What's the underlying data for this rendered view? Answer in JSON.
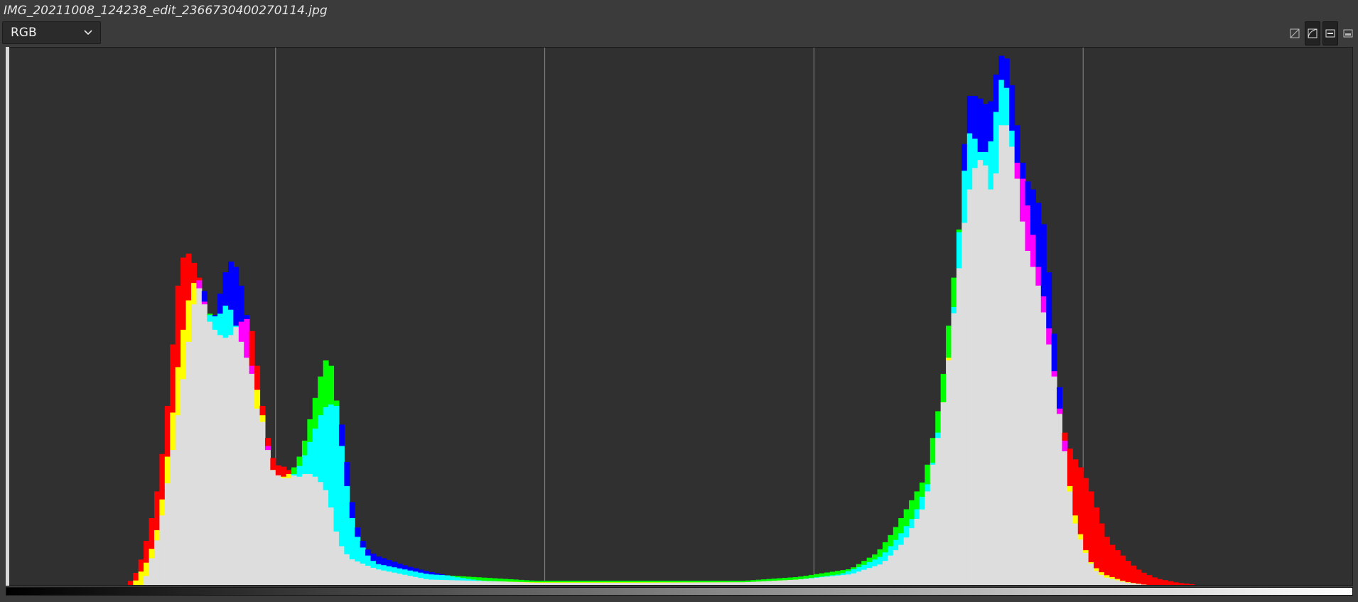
{
  "window": {
    "title": "IMG_20211008_124238_edit_2366730400270114.jpg"
  },
  "channel_select": {
    "value": "RGB",
    "icon": "chevron-down-icon"
  },
  "toolbar": {
    "buttons": [
      {
        "name": "linear-histogram-icon",
        "active": false
      },
      {
        "name": "log-histogram-icon",
        "active": true
      },
      {
        "name": "bars-histogram-icon",
        "active": true
      },
      {
        "name": "filled-histogram-icon",
        "active": false
      }
    ]
  },
  "colors": {
    "red": "#ff0000",
    "green": "#00ff00",
    "blue": "#0000ff",
    "yellow": "#ffff00",
    "cyan": "#00ffff",
    "magenta": "#ff00ff",
    "white": "#dddddd",
    "background": "#303030",
    "grid": "#8a8a8a"
  },
  "chart_data": {
    "type": "area",
    "title": "",
    "xlabel": "",
    "ylabel": "",
    "xlim": [
      0,
      255
    ],
    "ylim": [
      0,
      1
    ],
    "grid": true,
    "grid_x": [
      51,
      102,
      153,
      204
    ],
    "series": [
      {
        "name": "",
        "color": "red",
        "points": [
          [
            23,
            0
          ],
          [
            25,
            0.03
          ],
          [
            27,
            0.1
          ],
          [
            29,
            0.2
          ],
          [
            31,
            0.38
          ],
          [
            32,
            0.52
          ],
          [
            33,
            0.6
          ],
          [
            34,
            0.625
          ],
          [
            35,
            0.615
          ],
          [
            36,
            0.59
          ],
          [
            37,
            0.56
          ],
          [
            38,
            0.5
          ],
          [
            40,
            0.47
          ],
          [
            42,
            0.46
          ],
          [
            44,
            0.49
          ],
          [
            46,
            0.5
          ],
          [
            47,
            0.45
          ],
          [
            48,
            0.37
          ],
          [
            49,
            0.3
          ],
          [
            50,
            0.25
          ],
          [
            51,
            0.225
          ],
          [
            53,
            0.22
          ],
          [
            55,
            0.2
          ],
          [
            57,
            0.21
          ],
          [
            59,
            0.2
          ],
          [
            61,
            0.17
          ],
          [
            62,
            0.12
          ],
          [
            63,
            0.08
          ],
          [
            65,
            0.05
          ],
          [
            70,
            0.03
          ],
          [
            80,
            0.01
          ],
          [
            100,
            0.005
          ],
          [
            140,
            0.005
          ],
          [
            150,
            0.01
          ],
          [
            160,
            0.02
          ],
          [
            166,
            0.04
          ],
          [
            170,
            0.08
          ],
          [
            174,
            0.15
          ],
          [
            177,
            0.3
          ],
          [
            180,
            0.55
          ],
          [
            182,
            0.72
          ],
          [
            184,
            0.8
          ],
          [
            186,
            0.78
          ],
          [
            187,
            0.7
          ],
          [
            188,
            0.84
          ],
          [
            189,
            0.88
          ],
          [
            190,
            0.84
          ],
          [
            191,
            0.8
          ],
          [
            192,
            0.78
          ],
          [
            193,
            0.74
          ],
          [
            194,
            0.68
          ],
          [
            195,
            0.63
          ],
          [
            196,
            0.56
          ],
          [
            197,
            0.52
          ],
          [
            198,
            0.44
          ],
          [
            199,
            0.36
          ],
          [
            200,
            0.3
          ],
          [
            201,
            0.27
          ],
          [
            202,
            0.24
          ],
          [
            203,
            0.23
          ],
          [
            204,
            0.21
          ],
          [
            205,
            0.19
          ],
          [
            206,
            0.16
          ],
          [
            207,
            0.13
          ],
          [
            208,
            0.1
          ],
          [
            209,
            0.08
          ],
          [
            211,
            0.06
          ],
          [
            213,
            0.04
          ],
          [
            215,
            0.025
          ],
          [
            218,
            0.012
          ],
          [
            222,
            0.004
          ],
          [
            226,
            0
          ]
        ]
      },
      {
        "name": "",
        "color": "green",
        "points": [
          [
            24,
            0
          ],
          [
            27,
            0.05
          ],
          [
            29,
            0.12
          ],
          [
            31,
            0.28
          ],
          [
            33,
            0.45
          ],
          [
            35,
            0.56
          ],
          [
            36,
            0.57
          ],
          [
            37,
            0.54
          ],
          [
            38,
            0.51
          ],
          [
            40,
            0.5
          ],
          [
            42,
            0.53
          ],
          [
            44,
            0.47
          ],
          [
            46,
            0.41
          ],
          [
            48,
            0.35
          ],
          [
            50,
            0.22
          ],
          [
            52,
            0.2
          ],
          [
            54,
            0.21
          ],
          [
            56,
            0.25
          ],
          [
            58,
            0.33
          ],
          [
            60,
            0.41
          ],
          [
            61,
            0.43
          ],
          [
            62,
            0.39
          ],
          [
            63,
            0.3
          ],
          [
            64,
            0.22
          ],
          [
            65,
            0.15
          ],
          [
            66,
            0.1
          ],
          [
            68,
            0.06
          ],
          [
            70,
            0.04
          ],
          [
            80,
            0.02
          ],
          [
            100,
            0.008
          ],
          [
            140,
            0.008
          ],
          [
            150,
            0.015
          ],
          [
            160,
            0.03
          ],
          [
            165,
            0.06
          ],
          [
            168,
            0.1
          ],
          [
            171,
            0.15
          ],
          [
            174,
            0.2
          ],
          [
            177,
            0.35
          ],
          [
            179,
            0.53
          ],
          [
            181,
            0.71
          ],
          [
            182,
            0.84
          ],
          [
            183,
            0.85
          ],
          [
            184,
            0.82
          ],
          [
            185,
            0.8
          ],
          [
            186,
            0.82
          ],
          [
            187,
            0.84
          ],
          [
            188,
            0.93
          ],
          [
            189,
            0.96
          ],
          [
            190,
            0.9
          ],
          [
            191,
            0.8
          ],
          [
            192,
            0.72
          ],
          [
            193,
            0.64
          ],
          [
            194,
            0.61
          ],
          [
            195,
            0.58
          ],
          [
            196,
            0.54
          ],
          [
            197,
            0.48
          ],
          [
            198,
            0.42
          ],
          [
            199,
            0.36
          ],
          [
            200,
            0.28
          ],
          [
            201,
            0.22
          ],
          [
            202,
            0.15
          ],
          [
            203,
            0.11
          ],
          [
            204,
            0.08
          ],
          [
            205,
            0.05
          ],
          [
            206,
            0.035
          ],
          [
            208,
            0.02
          ],
          [
            212,
            0.006
          ],
          [
            216,
            0
          ]
        ]
      },
      {
        "name": "",
        "color": "blue",
        "points": [
          [
            26,
            0
          ],
          [
            29,
            0.1
          ],
          [
            31,
            0.22
          ],
          [
            33,
            0.35
          ],
          [
            35,
            0.49
          ],
          [
            36,
            0.56
          ],
          [
            37,
            0.58
          ],
          [
            38,
            0.52
          ],
          [
            39,
            0.49
          ],
          [
            40,
            0.52
          ],
          [
            41,
            0.57
          ],
          [
            42,
            0.6
          ],
          [
            43,
            0.61
          ],
          [
            44,
            0.58
          ],
          [
            45,
            0.54
          ],
          [
            46,
            0.47
          ],
          [
            47,
            0.35
          ],
          [
            48,
            0.31
          ],
          [
            49,
            0.3
          ],
          [
            50,
            0.22
          ],
          [
            52,
            0.2
          ],
          [
            54,
            0.2
          ],
          [
            56,
            0.23
          ],
          [
            58,
            0.28
          ],
          [
            60,
            0.33
          ],
          [
            62,
            0.34
          ],
          [
            63,
            0.33
          ],
          [
            64,
            0.27
          ],
          [
            65,
            0.19
          ],
          [
            66,
            0.12
          ],
          [
            68,
            0.07
          ],
          [
            70,
            0.055
          ],
          [
            73,
            0.045
          ],
          [
            76,
            0.035
          ],
          [
            80,
            0.025
          ],
          [
            85,
            0.015
          ],
          [
            90,
            0.008
          ],
          [
            100,
            0.004
          ],
          [
            120,
            0.004
          ],
          [
            140,
            0.005
          ],
          [
            150,
            0.01
          ],
          [
            158,
            0.02
          ],
          [
            162,
            0.035
          ],
          [
            166,
            0.055
          ],
          [
            169,
            0.09
          ],
          [
            172,
            0.13
          ],
          [
            175,
            0.2
          ],
          [
            178,
            0.37
          ],
          [
            180,
            0.57
          ],
          [
            181,
            0.75
          ],
          [
            182,
            0.9
          ],
          [
            183,
            0.93
          ],
          [
            184,
            0.9
          ],
          [
            185,
            0.92
          ],
          [
            186,
            0.88
          ],
          [
            187,
            0.93
          ],
          [
            188,
            0.98
          ],
          [
            189,
            1.0
          ],
          [
            190,
            0.97
          ],
          [
            191,
            0.9
          ],
          [
            192,
            0.82
          ],
          [
            193,
            0.76
          ],
          [
            194,
            0.75
          ],
          [
            195,
            0.73
          ],
          [
            196,
            0.7
          ],
          [
            197,
            0.65
          ],
          [
            198,
            0.52
          ],
          [
            199,
            0.42
          ],
          [
            200,
            0.32
          ],
          [
            201,
            0.22
          ],
          [
            202,
            0.13
          ],
          [
            203,
            0.1
          ],
          [
            204,
            0.07
          ],
          [
            205,
            0.05
          ],
          [
            206,
            0.03
          ],
          [
            208,
            0.015
          ],
          [
            212,
            0.005
          ],
          [
            216,
            0
          ]
        ]
      },
      {
        "name": "",
        "color": "white",
        "points": [
          [
            25,
            0
          ],
          [
            27,
            0.04
          ],
          [
            29,
            0.1
          ],
          [
            31,
            0.2
          ],
          [
            33,
            0.35
          ],
          [
            35,
            0.42
          ],
          [
            37,
            0.44
          ],
          [
            38,
            0.42
          ],
          [
            39,
            0.39
          ],
          [
            40,
            0.4
          ],
          [
            41,
            0.41
          ],
          [
            42,
            0.4
          ],
          [
            43,
            0.4
          ],
          [
            44,
            0.38
          ],
          [
            45,
            0.35
          ],
          [
            46,
            0.3
          ],
          [
            47,
            0.25
          ],
          [
            48,
            0.22
          ],
          [
            50,
            0.2
          ],
          [
            52,
            0.17
          ],
          [
            54,
            0.15
          ],
          [
            55,
            0.16
          ],
          [
            56,
            0.18
          ],
          [
            58,
            0.19
          ],
          [
            60,
            0.21
          ],
          [
            61,
            0.22
          ],
          [
            62,
            0.2
          ],
          [
            63,
            0.18
          ],
          [
            64,
            0.14
          ],
          [
            65,
            0.1
          ],
          [
            66,
            0.07
          ],
          [
            68,
            0.04
          ],
          [
            70,
            0.02
          ],
          [
            80,
            0.008
          ],
          [
            100,
            0.003
          ],
          [
            140,
            0.003
          ],
          [
            150,
            0.006
          ],
          [
            160,
            0.015
          ],
          [
            165,
            0.035
          ],
          [
            168,
            0.06
          ],
          [
            171,
            0.1
          ],
          [
            174,
            0.14
          ],
          [
            177,
            0.25
          ],
          [
            179,
            0.45
          ],
          [
            181,
            0.62
          ],
          [
            182,
            0.64
          ],
          [
            183,
            0.66
          ],
          [
            184,
            0.65
          ],
          [
            185,
            0.67
          ],
          [
            186,
            0.68
          ],
          [
            187,
            0.72
          ],
          [
            188,
            0.82
          ],
          [
            189,
            0.83
          ],
          [
            190,
            0.82
          ],
          [
            191,
            0.76
          ],
          [
            192,
            0.66
          ],
          [
            193,
            0.62
          ],
          [
            194,
            0.61
          ],
          [
            195,
            0.6
          ],
          [
            196,
            0.58
          ],
          [
            197,
            0.52
          ],
          [
            198,
            0.45
          ],
          [
            199,
            0.38
          ],
          [
            200,
            0.31
          ],
          [
            201,
            0.25
          ],
          [
            202,
            0.17
          ],
          [
            203,
            0.12
          ],
          [
            204,
            0.08
          ],
          [
            205,
            0.05
          ],
          [
            206,
            0.03
          ],
          [
            208,
            0.014
          ],
          [
            212,
            0.004
          ],
          [
            216,
            0
          ]
        ]
      }
    ]
  }
}
